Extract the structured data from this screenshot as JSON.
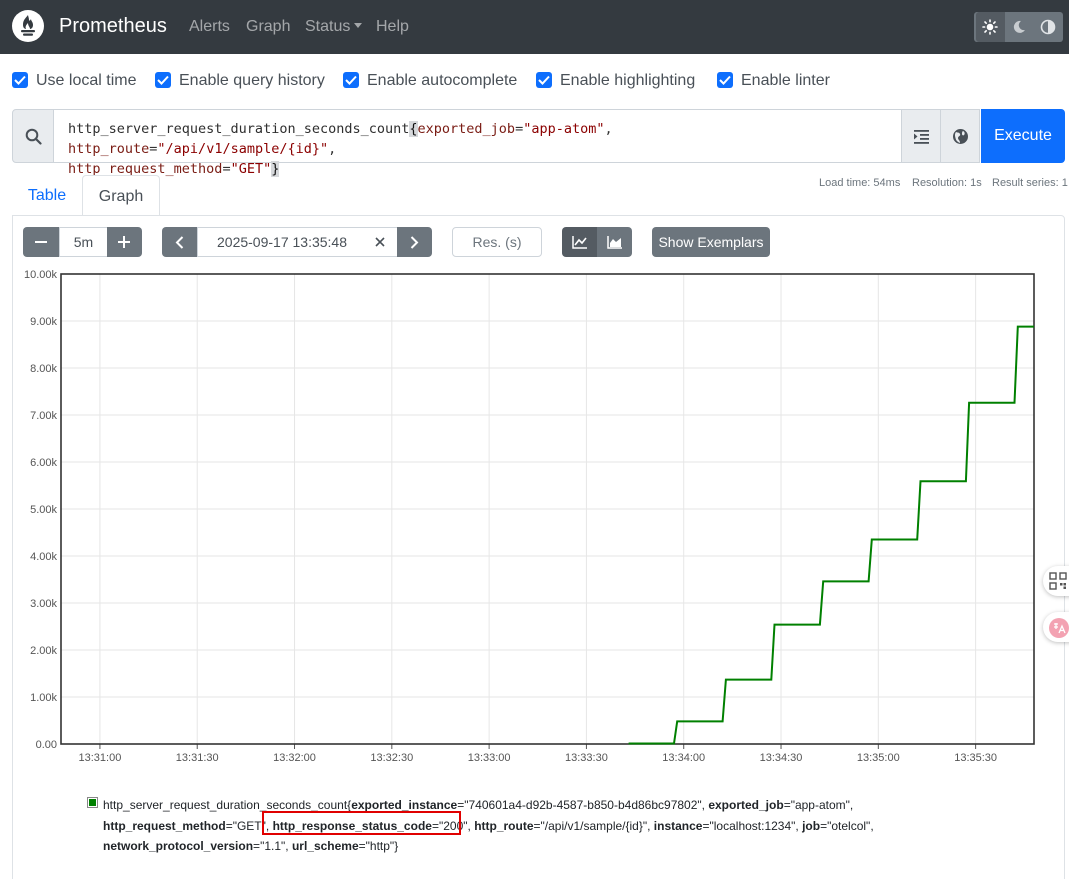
{
  "navbar": {
    "brand": "Prometheus",
    "links": [
      {
        "label": "Alerts"
      },
      {
        "label": "Graph"
      },
      {
        "label": "Status"
      },
      {
        "label": "Help"
      }
    ],
    "theme_active": "light"
  },
  "options": [
    {
      "label": "Use local time",
      "checked": true
    },
    {
      "label": "Enable query history",
      "checked": true
    },
    {
      "label": "Enable autocomplete",
      "checked": true
    },
    {
      "label": "Enable highlighting",
      "checked": true
    },
    {
      "label": "Enable linter",
      "checked": true
    }
  ],
  "query": {
    "metric": "http_server_request_duration_seconds_count",
    "open_brace": "{",
    "close_brace": "}",
    "matchers": [
      {
        "label": "exported_job",
        "op": "=",
        "value": "\"app-atom\"",
        "sep": ", "
      },
      {
        "label": "http_route",
        "op": "=",
        "value": "\"/api/v1/sample/{id}\"",
        "sep": ","
      },
      {
        "label": "http_request_method",
        "op": "=",
        "value": "\"GET\"",
        "sep": ""
      }
    ],
    "execute_label": "Execute"
  },
  "tabs": {
    "table_label": "Table",
    "graph_label": "Graph",
    "active": "graph"
  },
  "stats": {
    "load_time": "Load time: 54ms",
    "resolution": "Resolution: 1s",
    "result_series": "Result series: 1"
  },
  "controls": {
    "range": "5m",
    "end_time": "2025-09-17 13:35:48",
    "resolution_placeholder": "Res. (s)",
    "exemplars_label": "Show Exemplars",
    "chart_mode": "line"
  },
  "colors": {
    "series": "#008000",
    "accent": "#0d6efd",
    "navbar": "#343a40",
    "highlight_box": "#e00000"
  },
  "chart_data": {
    "type": "line",
    "y_ticks": [
      "0.00",
      "1.00k",
      "2.00k",
      "3.00k",
      "4.00k",
      "5.00k",
      "6.00k",
      "7.00k",
      "8.00k",
      "9.00k",
      "10.00k"
    ],
    "x_ticks": [
      "13:31:00",
      "13:31:30",
      "13:32:00",
      "13:32:30",
      "13:33:00",
      "13:33:30",
      "13:34:00",
      "13:34:30",
      "13:35:00",
      "13:35:30"
    ],
    "x_range": [
      "13:30:48",
      "13:35:48"
    ],
    "ylim": [
      0,
      10000
    ],
    "grid": true,
    "series": [
      {
        "color": "#008000",
        "points": [
          [
            "13:33:43",
            10
          ],
          [
            "13:33:57",
            10
          ],
          [
            "13:33:58",
            480
          ],
          [
            "13:34:12",
            480
          ],
          [
            "13:34:13",
            1370
          ],
          [
            "13:34:27",
            1370
          ],
          [
            "13:34:28",
            2540
          ],
          [
            "13:34:42",
            2540
          ],
          [
            "13:34:43",
            3460
          ],
          [
            "13:34:57",
            3460
          ],
          [
            "13:34:58",
            4350
          ],
          [
            "13:35:12",
            4350
          ],
          [
            "13:35:13",
            5590
          ],
          [
            "13:35:27",
            5590
          ],
          [
            "13:35:28",
            7260
          ],
          [
            "13:35:42",
            7260
          ],
          [
            "13:35:43",
            8880
          ],
          [
            "13:35:48",
            8880
          ]
        ]
      }
    ]
  },
  "legend": {
    "metric": "http_server_request_duration_seconds_count",
    "labels": [
      {
        "key": "exported_instance",
        "value": "\"740601a4-d92b-4587-b850-b4d86bc97802\"",
        "sep": ", "
      },
      {
        "key": "exported_job",
        "value": "\"app-atom\"",
        "sep": ","
      },
      {
        "key": "http_request_method",
        "value": "\"GET\"",
        "sep": ", "
      },
      {
        "key": "http_response_status_code",
        "value": "\"200\"",
        "sep": ", "
      },
      {
        "key": "http_route",
        "value": "\"/api/v1/sample/{id}\"",
        "sep": ", "
      },
      {
        "key": "instance",
        "value": "\"localhost:1234\"",
        "sep": ", "
      },
      {
        "key": "job",
        "value": "\"otelcol\"",
        "sep": ","
      },
      {
        "key": "network_protocol_version",
        "value": "\"1.1\"",
        "sep": ", "
      },
      {
        "key": "url_scheme",
        "value": "\"http\"",
        "sep": ""
      }
    ],
    "open_brace": "{",
    "close_brace": "}"
  }
}
